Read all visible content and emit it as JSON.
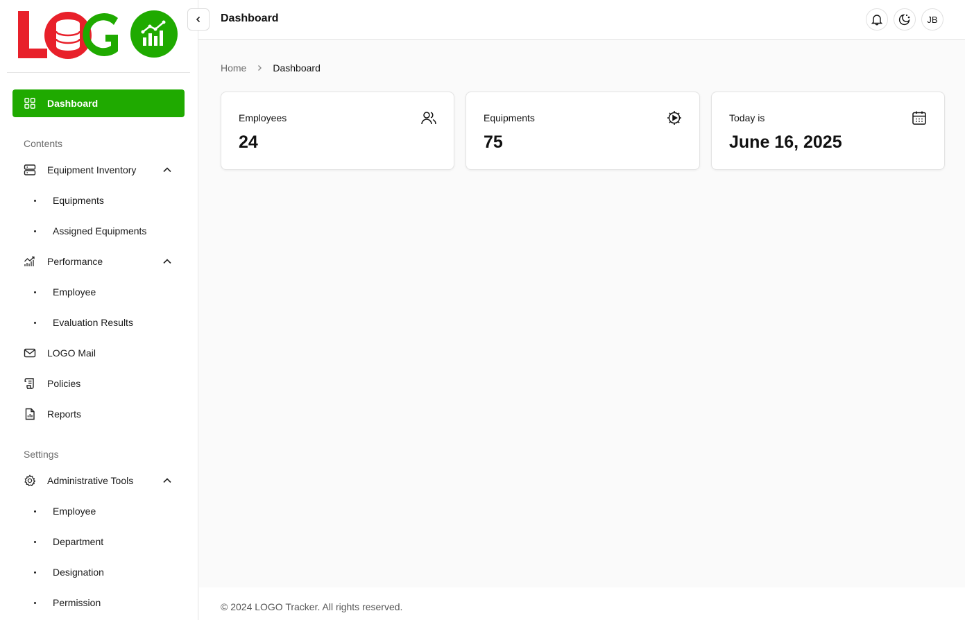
{
  "logo": {
    "text": "LOGO",
    "icon": "logo-database-chart-icon",
    "colors": {
      "red": "#e8202a",
      "green": "#1faa00"
    }
  },
  "header": {
    "title": "Dashboard",
    "avatar_initials": "JB",
    "icons": [
      "bell-icon",
      "theme-moon-icon"
    ]
  },
  "breadcrumb": {
    "home": "Home",
    "current": "Dashboard"
  },
  "sidebar": {
    "active": "Dashboard",
    "contents_label": "Contents",
    "settings_label": "Settings",
    "equipment_inventory": {
      "label": "Equipment Inventory",
      "children": [
        "Equipments",
        "Assigned Equipments"
      ]
    },
    "performance": {
      "label": "Performance",
      "children": [
        "Employee",
        "Evaluation Results"
      ]
    },
    "logo_mail": "LOGO Mail",
    "policies": "Policies",
    "reports": "Reports",
    "administrative_tools": {
      "label": "Administrative Tools",
      "children": [
        "Employee",
        "Department",
        "Designation",
        "Permission"
      ]
    }
  },
  "cards": [
    {
      "label": "Employees",
      "value": "24",
      "icon": "users-icon"
    },
    {
      "label": "Equipments",
      "value": "75",
      "icon": "gear-play-icon"
    },
    {
      "label": "Today is",
      "value": "June 16, 2025",
      "icon": "calendar-icon"
    }
  ],
  "footer": {
    "text": "© 2024 LOGO Tracker. All rights reserved."
  },
  "accent_color": "#1faa00"
}
